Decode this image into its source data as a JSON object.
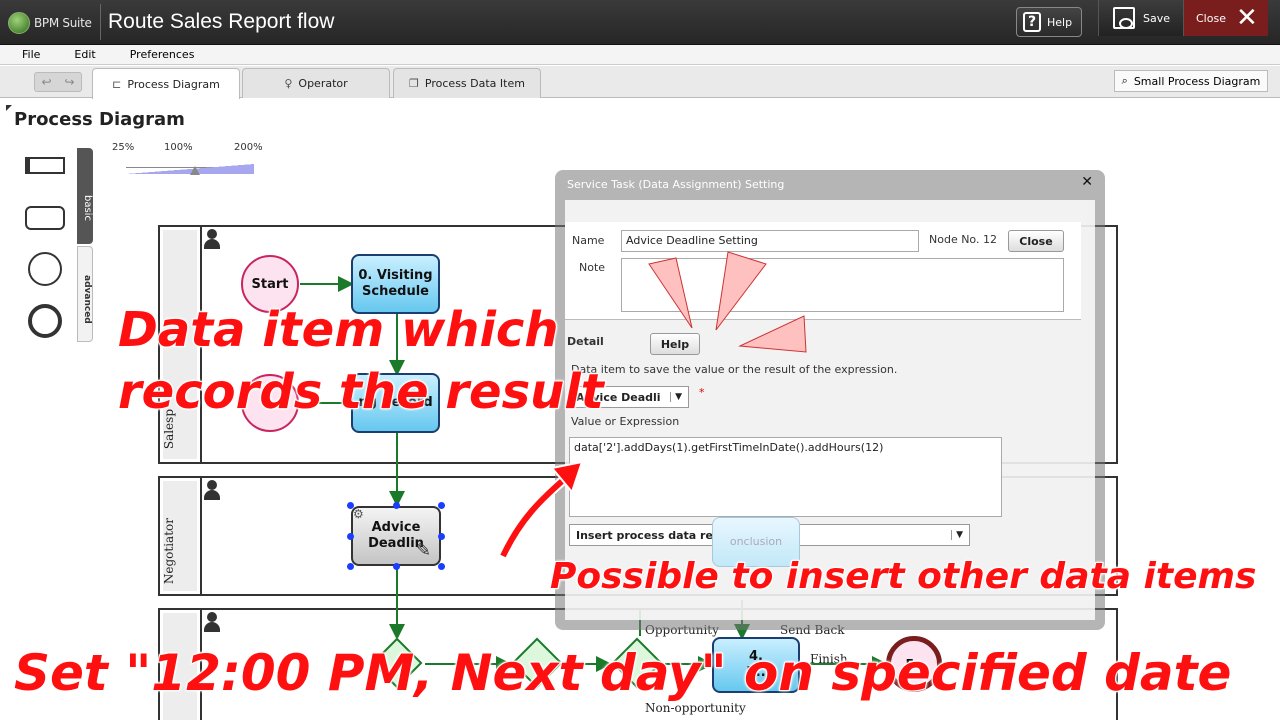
{
  "app": {
    "logo_text": "BPM Suite",
    "title": "Route Sales Report flow",
    "help_label": "Help",
    "save_label": "Save",
    "close_label": "Close"
  },
  "menu": [
    "File",
    "Edit",
    "Preferences"
  ],
  "tabs": [
    {
      "label": "Process Diagram",
      "active": true,
      "icon": "diagram-icon"
    },
    {
      "label": "Operator",
      "active": false,
      "icon": "person-icon"
    },
    {
      "label": "Process Data Item",
      "active": false,
      "icon": "copy-icon"
    }
  ],
  "small_diagram_label": "Small Process Diagram",
  "page_title": "Process Diagram",
  "palette": {
    "tab_basic": "basic",
    "tab_advanced": "advanced"
  },
  "zoom": {
    "min_label": "25%",
    "mid_label": "100%",
    "max_label": "200%",
    "value_percent": 100
  },
  "diagram": {
    "lanes": [
      "Salesp",
      "Negotiator",
      ""
    ],
    "start_label": "Start",
    "task0": "0. Visiting Schedule",
    "task1": "ng Record",
    "task_advice": "Advice Deadlin",
    "task4": "4.",
    "task4b": "i...",
    "end_label": "En",
    "faint_label": "onclusion",
    "flow_labels": {
      "opportunity": "Opportunity",
      "send_back": "Send Back",
      "finish": "Finish",
      "non_opportunity": "Non-opportunity"
    }
  },
  "dialog": {
    "title": "Service Task (Data Assignment) Setting",
    "name_label": "Name",
    "name_value": "Advice Deadline Setting",
    "node_no": "Node No. 12",
    "close_button": "Close",
    "note_label": "Note",
    "detail_label": "Detail",
    "help_button": "Help",
    "save_desc": "Data item to save the value or the result of the expression.",
    "data_item_selected": "Advice Deadli",
    "required_mark": "*",
    "value_label": "Value or Expression",
    "expression": "data['2'].addDays(1).getFirstTimeInDate().addHours(12)",
    "insert_ref_label": "Insert process data reference..."
  },
  "annotations": {
    "line1": "Data item  which",
    "line2": "records the result",
    "insert_note": "Possible to insert other data items",
    "bottom": "Set \"12:00 PM, Next day\" on specified date"
  },
  "colors": {
    "annotation": "#ff1010",
    "close_bg": "#7a1d1d",
    "task_blue": "#66c8ef",
    "flow_green": "#1a7a2a"
  }
}
